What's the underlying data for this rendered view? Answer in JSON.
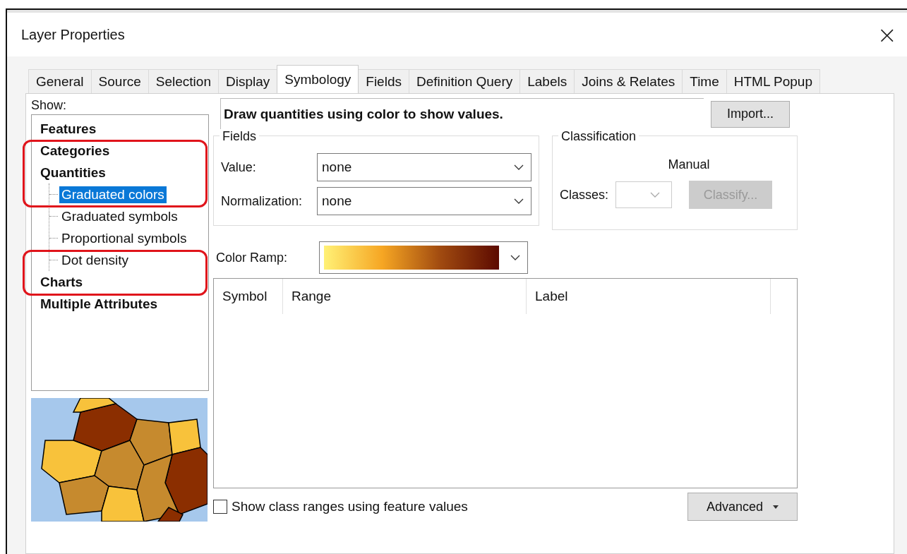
{
  "window": {
    "title": "Layer Properties",
    "close": "×"
  },
  "tabs": [
    {
      "label": "General",
      "selected": false
    },
    {
      "label": "Source",
      "selected": false
    },
    {
      "label": "Selection",
      "selected": false
    },
    {
      "label": "Display",
      "selected": false
    },
    {
      "label": "Symbology",
      "selected": true
    },
    {
      "label": "Fields",
      "selected": false
    },
    {
      "label": "Definition Query",
      "selected": false
    },
    {
      "label": "Labels",
      "selected": false
    },
    {
      "label": "Joins & Relates",
      "selected": false
    },
    {
      "label": "Time",
      "selected": false
    },
    {
      "label": "HTML Popup",
      "selected": false
    }
  ],
  "show_label": "Show:",
  "tree": [
    {
      "label": "Features",
      "selected": false
    },
    {
      "label": "Categories",
      "selected": false
    },
    {
      "label": "Quantities",
      "selected": false,
      "children": [
        {
          "label": "Graduated colors",
          "selected": true
        },
        {
          "label": "Graduated symbols",
          "selected": false
        },
        {
          "label": "Proportional symbols",
          "selected": false
        },
        {
          "label": "Dot density",
          "selected": false
        }
      ]
    },
    {
      "label": "Charts",
      "selected": false
    },
    {
      "label": "Multiple Attributes",
      "selected": false
    }
  ],
  "annotations": [
    {
      "kind": "highlight",
      "color": "#e0141b"
    },
    {
      "kind": "highlight",
      "color": "#e0141b"
    }
  ],
  "description": "Draw quantities using color to show values.",
  "import_button": "Import...",
  "fields": {
    "title": "Fields",
    "value_label": "Value:",
    "value": "none",
    "normalization_label": "Normalization:",
    "normalization": "none"
  },
  "classification": {
    "title": "Classification",
    "method": "Manual",
    "classes_label": "Classes:",
    "classify_button": "Classify...",
    "classify_disabled": true
  },
  "color_ramp": {
    "label": "Color Ramp:"
  },
  "table": {
    "columns": [
      "Symbol",
      "Range",
      "Label"
    ]
  },
  "show_class_ranges": {
    "label": "Show class ranges using feature values",
    "checked": false
  },
  "advanced_button": "Advanced"
}
